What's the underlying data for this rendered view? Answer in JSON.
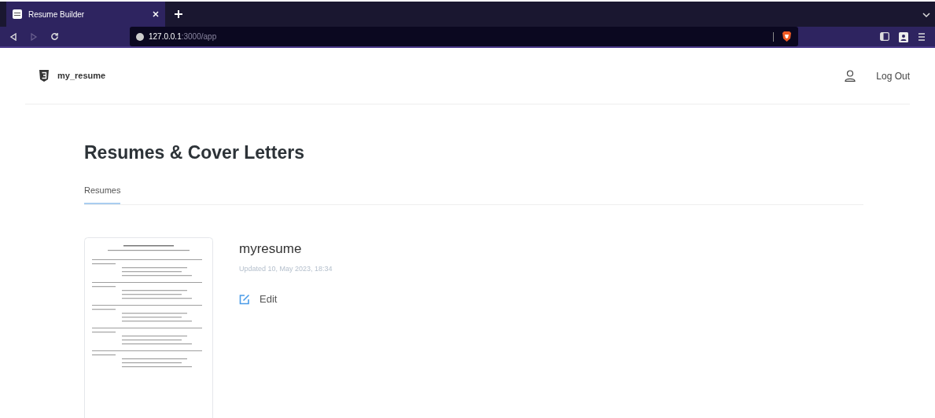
{
  "browser": {
    "tabs": [
      {
        "title": "Resume Builder",
        "selected": true
      }
    ],
    "address": {
      "host": "127.0.0.1",
      "rest": ":3000/app"
    }
  },
  "header": {
    "brand": "my_resume",
    "logout": "Log Out"
  },
  "page": {
    "title": "Resumes & Cover Letters",
    "tabs": [
      {
        "label": "Resumes",
        "selected": true
      }
    ]
  },
  "resumes": [
    {
      "name": "myresume",
      "updated": "Updated 10, May 2023, 18:34",
      "action": "Edit"
    }
  ]
}
